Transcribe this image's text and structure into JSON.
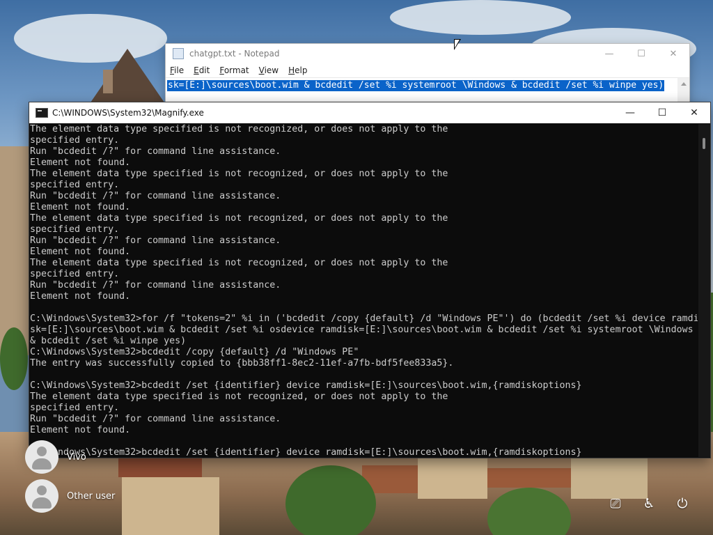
{
  "notepad": {
    "title": "chatgpt.txt - Notepad",
    "menu": [
      {
        "label": "File",
        "underline": "F",
        "rest": "ile"
      },
      {
        "label": "Edit",
        "underline": "E",
        "rest": "dit"
      },
      {
        "label": "Format",
        "underline": "F",
        "rest": "ormat"
      },
      {
        "label": "View",
        "underline": "V",
        "rest": "iew"
      },
      {
        "label": "Help",
        "underline": "H",
        "rest": "elp"
      }
    ],
    "selected_text": "sk=[E:]\\sources\\boot.wim & bcdedit /set %i systemroot \\Windows & bcdedit /set %i winpe yes)",
    "selection_color": "#0a63c9"
  },
  "console": {
    "title": "C:\\WINDOWS\\System32\\Magnify.exe",
    "lines": [
      "The element data type specified is not recognized, or does not apply to the",
      "specified entry.",
      "Run \"bcdedit /?\" for command line assistance.",
      "Element not found.",
      "The element data type specified is not recognized, or does not apply to the",
      "specified entry.",
      "Run \"bcdedit /?\" for command line assistance.",
      "Element not found.",
      "The element data type specified is not recognized, or does not apply to the",
      "specified entry.",
      "Run \"bcdedit /?\" for command line assistance.",
      "Element not found.",
      "The element data type specified is not recognized, or does not apply to the",
      "specified entry.",
      "Run \"bcdedit /?\" for command line assistance.",
      "Element not found.",
      "",
      "C:\\Windows\\System32>for /f \"tokens=2\" %i in ('bcdedit /copy {default} /d \"Windows PE\"') do (bcdedit /set %i device ramdi",
      "sk=[E:]\\sources\\boot.wim & bcdedit /set %i osdevice ramdisk=[E:]\\sources\\boot.wim & bcdedit /set %i systemroot \\Windows",
      "& bcdedit /set %i winpe yes)",
      "C:\\Windows\\System32>bcdedit /copy {default} /d \"Windows PE\"",
      "The entry was successfully copied to {bbb38ff1-8ec2-11ef-a7fb-bdf5fee833a5}.",
      "",
      "C:\\Windows\\System32>bcdedit /set {identifier} device ramdisk=[E:]\\sources\\boot.wim,{ramdiskoptions}",
      "The element data type specified is not recognized, or does not apply to the",
      "specified entry.",
      "Run \"bcdedit /?\" for command line assistance.",
      "Element not found.",
      "",
      "C:\\Windows\\System32>bcdedit /set {identifier} device ramdisk=[E:]\\sources\\boot.wim,{ramdiskoptions}"
    ],
    "text_color": "#cccccc",
    "background": "#0c0c0c"
  },
  "window_controls": {
    "minimize": "—",
    "maximize": "☐",
    "close": "✕"
  },
  "lock_screen": {
    "users": [
      {
        "name": "Vivo"
      },
      {
        "name": "Other user"
      }
    ],
    "tray": [
      {
        "icon": "network-icon",
        "glyph": "⎚"
      },
      {
        "icon": "accessibility-icon",
        "glyph": "♿"
      },
      {
        "icon": "power-icon",
        "glyph": "⏻"
      }
    ]
  }
}
